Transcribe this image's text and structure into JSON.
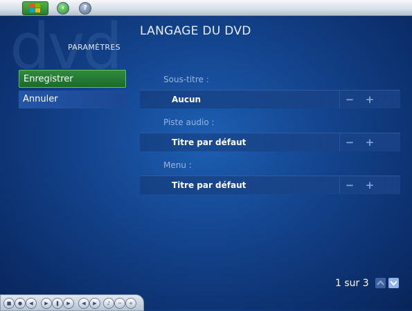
{
  "header": {
    "back_icon": "back-arrow-icon",
    "help_icon": "help-icon",
    "logo_icon": "windows-logo-icon",
    "watermark": "dvd"
  },
  "page": {
    "title": "LANGAGE DU DVD",
    "section": "PARAMÈTRES"
  },
  "menu": {
    "save_label": "Enregistrer",
    "cancel_label": "Annuler"
  },
  "settings": [
    {
      "label": "Sous-titre :",
      "value": "Aucun"
    },
    {
      "label": "Piste audio :",
      "value": "Titre par défaut"
    },
    {
      "label": "Menu :",
      "value": "Titre par défaut"
    }
  ],
  "controls": {
    "minus": "−",
    "plus": "+"
  },
  "pager": {
    "text": "1 sur 3"
  },
  "colors": {
    "background": "#123f86",
    "selected": "#2f8a3d",
    "accent": "#8fb3ea"
  }
}
